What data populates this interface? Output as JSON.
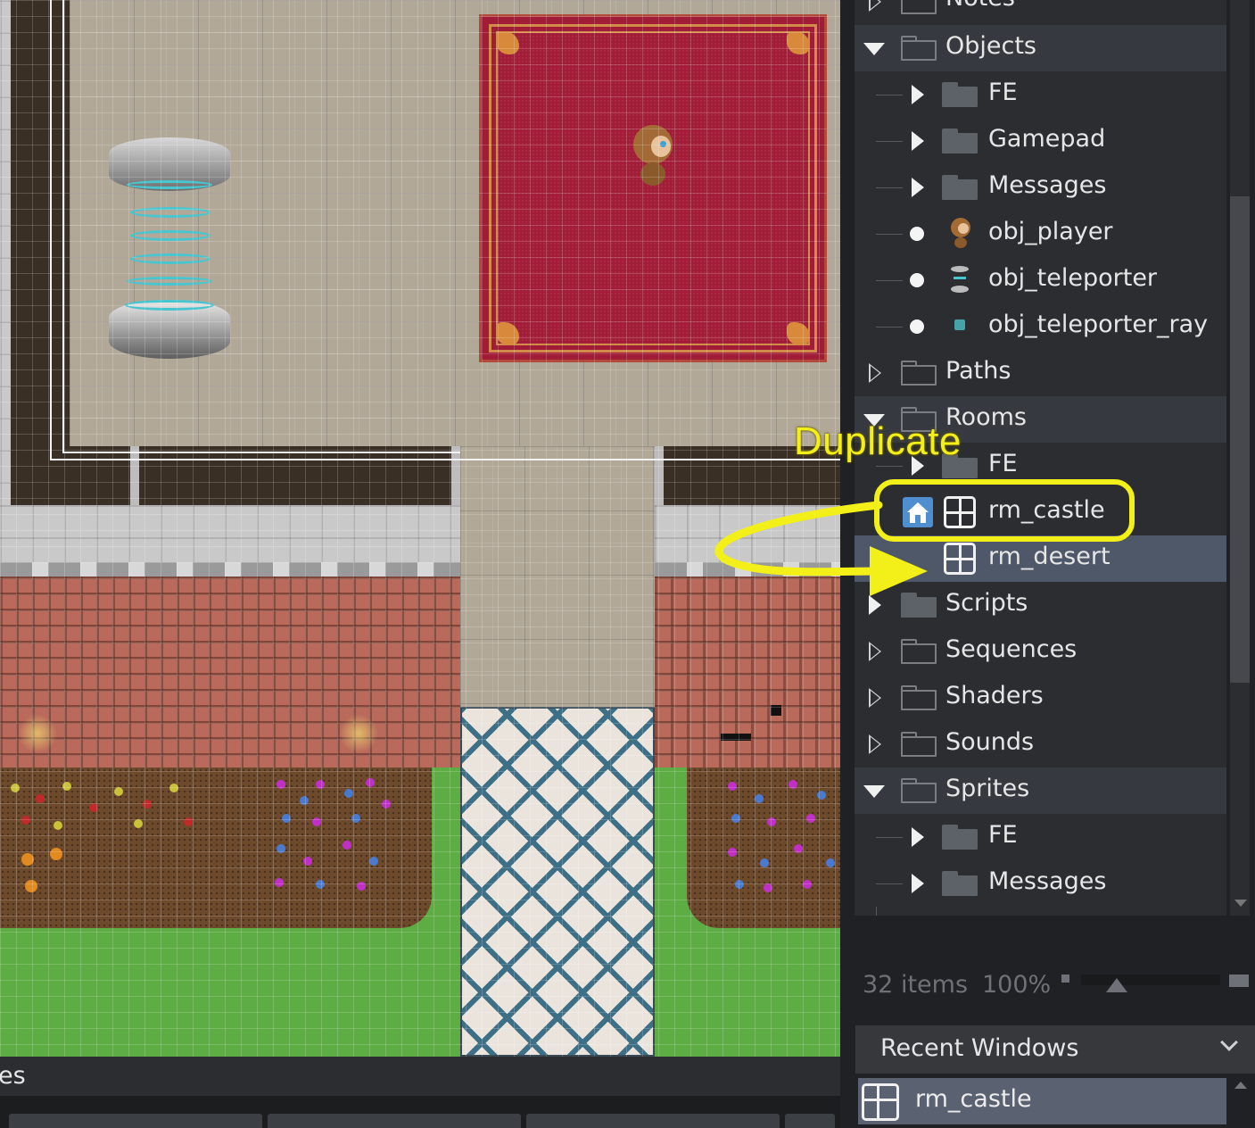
{
  "asset_browser": {
    "rows": [
      {
        "label": "Notes",
        "kind": "group-collapsed"
      },
      {
        "label": "Objects",
        "kind": "group-expanded"
      },
      {
        "label": "FE",
        "kind": "subfolder"
      },
      {
        "label": "Gamepad",
        "kind": "subfolder"
      },
      {
        "label": "Messages",
        "kind": "subfolder"
      },
      {
        "label": "obj_player",
        "kind": "object",
        "icon": "player-sprite-icon"
      },
      {
        "label": "obj_teleporter",
        "kind": "object",
        "icon": "teleporter-sprite-icon"
      },
      {
        "label": "obj_teleporter_ray",
        "kind": "object",
        "icon": "teleporter-ray-sprite-icon"
      },
      {
        "label": "Paths",
        "kind": "group-collapsed"
      },
      {
        "label": "Rooms",
        "kind": "group-expanded"
      },
      {
        "label": "FE",
        "kind": "subfolder"
      },
      {
        "label": "rm_castle",
        "kind": "room",
        "home": true
      },
      {
        "label": "rm_desert",
        "kind": "room",
        "selected": true
      },
      {
        "label": "Scripts",
        "kind": "group-collapsed-filled"
      },
      {
        "label": "Sequences",
        "kind": "group-collapsed"
      },
      {
        "label": "Shaders",
        "kind": "group-collapsed"
      },
      {
        "label": "Sounds",
        "kind": "group-collapsed"
      },
      {
        "label": "Sprites",
        "kind": "group-expanded"
      },
      {
        "label": "FE",
        "kind": "subfolder"
      },
      {
        "label": "Messages",
        "kind": "subfolder"
      }
    ],
    "status": {
      "items": "32 items",
      "zoom": "100%"
    }
  },
  "recent_windows": {
    "header": "Recent Windows",
    "items": [
      {
        "label": "rm_castle",
        "icon": "room-icon"
      }
    ]
  },
  "output_tab": {
    "label": "es"
  },
  "annotation": {
    "text": "Duplicate",
    "color": "#f3f019"
  },
  "colors": {
    "selected_row": "#4f5868",
    "group_row": "#363a40",
    "panel_bg": "#2b2d30",
    "red_carpet": "#a11c36",
    "grass": "#5dad44"
  }
}
